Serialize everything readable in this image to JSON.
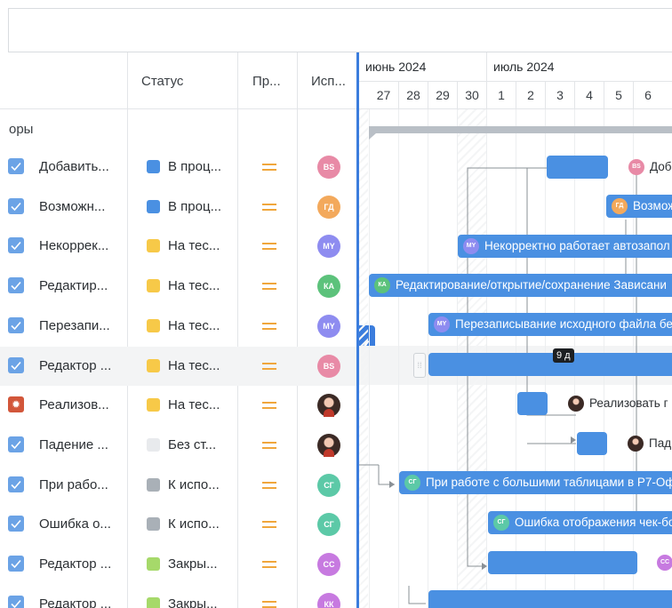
{
  "grid": {
    "columns": {
      "status": "Статус",
      "priority": "Пр...",
      "assignee": "Исп..."
    },
    "group_label": "оры",
    "rows": [
      {
        "icon": "checkbox-icon",
        "name": "Добавить...",
        "status": "В проц...",
        "status_color": "#4a90e2",
        "assignee": "BS",
        "assignee_color": "#e88aa6"
      },
      {
        "icon": "checkbox-icon",
        "name": "Возможн...",
        "status": "В проц...",
        "status_color": "#4a90e2",
        "assignee": "ГД",
        "assignee_color": "#f3a95c"
      },
      {
        "icon": "checkbox-icon",
        "name": "Некоррек...",
        "status": "На тес...",
        "status_color": "#f7c948",
        "assignee": "MY",
        "assignee_color": "#8e8cf0"
      },
      {
        "icon": "checkbox-icon",
        "name": "Редактир...",
        "status": "На тес...",
        "status_color": "#f7c948",
        "assignee": "КА",
        "assignee_color": "#5cc27b"
      },
      {
        "icon": "checkbox-icon",
        "name": "Перезапи...",
        "status": "На тес...",
        "status_color": "#f7c948",
        "assignee": "MY",
        "assignee_color": "#8e8cf0"
      },
      {
        "icon": "checkbox-icon",
        "name": "Редактор ...",
        "status": "На тес...",
        "status_color": "#f7c948",
        "assignee": "BS",
        "assignee_color": "#e88aa6"
      },
      {
        "icon": "bug-icon",
        "name": "Реализов...",
        "status": "На тес...",
        "status_color": "#f7c948",
        "assignee": "",
        "assignee_color": "photo"
      },
      {
        "icon": "checkbox-icon",
        "name": "Падение ...",
        "status": "Без ст...",
        "status_color": "#e8eaed",
        "assignee": "",
        "assignee_color": "photo"
      },
      {
        "icon": "checkbox-icon",
        "name": "При рабо...",
        "status": "К испо...",
        "status_color": "#a9b0b7",
        "assignee": "СГ",
        "assignee_color": "#5cc9a7"
      },
      {
        "icon": "checkbox-icon",
        "name": "Ошибка о...",
        "status": "К испо...",
        "status_color": "#a9b0b7",
        "assignee": "СГ",
        "assignee_color": "#5cc9a7"
      },
      {
        "icon": "checkbox-icon",
        "name": "Редактор ...",
        "status": "Закры...",
        "status_color": "#a6d96a",
        "assignee": "СС",
        "assignee_color": "#c77ae0"
      },
      {
        "icon": "checkbox-icon",
        "name": "Редактор ...",
        "status": "Закры...",
        "status_color": "#a6d96a",
        "assignee": "КК",
        "assignee_color": "#c77ae0"
      }
    ]
  },
  "timeline": {
    "months": [
      "июнь 2024",
      "июль 2024"
    ],
    "days": [
      "27",
      "28",
      "29",
      "30",
      "1",
      "2",
      "3",
      "4",
      "5",
      "6"
    ],
    "duration_tooltip": "9 д",
    "bars": [
      {
        "label": "Доб",
        "initials": "BS",
        "color": "#e88aa6"
      },
      {
        "label": "Возмож",
        "initials": "ГД",
        "color": "#f3a95c"
      },
      {
        "label": "Некорректно работает автозапол",
        "initials": "MY",
        "color": "#8e8cf0"
      },
      {
        "label": "Редактирование/открытие/сохранение Зависани",
        "initials": "КА",
        "color": "#5cc27b"
      },
      {
        "label": "Перезаписывание исходного файла бе",
        "initials": "MY",
        "color": "#8e8cf0"
      },
      {
        "label": "Реализовать г"
      },
      {
        "label": "Пад"
      },
      {
        "label": "При работе с большими таблицами в Р7-Оф",
        "initials": "СГ",
        "color": "#5cc9a7"
      },
      {
        "label": "Ошибка отображения чек-бо",
        "initials": "СГ",
        "color": "#5cc9a7"
      },
      {
        "initials": "СС",
        "color": "#c77ae0"
      }
    ]
  },
  "colors": {
    "accent": "#3b7ddd",
    "bar": "#4a90e2",
    "priority": "#f0a63c"
  }
}
